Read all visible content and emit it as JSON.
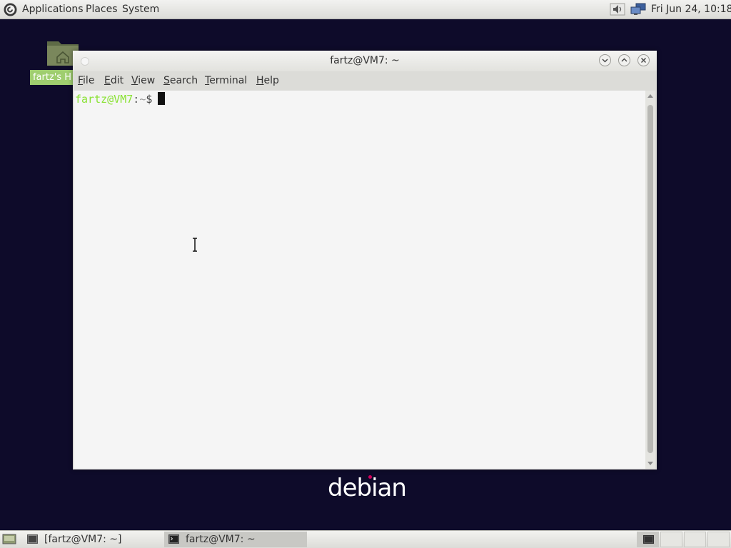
{
  "top_panel": {
    "menus": [
      "Applications",
      "Places",
      "System"
    ],
    "clock": "Fri Jun 24, 10:18",
    "icons": [
      "debian-swirl-icon",
      "volume-icon",
      "network-icon"
    ]
  },
  "desktop": {
    "home_icon_label": "fartz's H"
  },
  "terminal": {
    "title": "fartz@VM7: ~",
    "menus": [
      {
        "label": "File",
        "mnemonic": "F"
      },
      {
        "label": "Edit",
        "mnemonic": "E"
      },
      {
        "label": "View",
        "mnemonic": "V"
      },
      {
        "label": "Search",
        "mnemonic": "S"
      },
      {
        "label": "Terminal",
        "mnemonic": "T"
      },
      {
        "label": "Help",
        "mnemonic": "H"
      }
    ],
    "prompt": {
      "user_host": "fartz@VM7",
      "sep": ":",
      "path": "~",
      "dollar": "$"
    },
    "window_buttons": [
      "minimize",
      "maximize",
      "close"
    ]
  },
  "wallpaper": {
    "wordmark": "debian"
  },
  "taskbar": {
    "tasks": [
      {
        "label": "[fartz@VM7: ~]",
        "active": false
      },
      {
        "label": "fartz@VM7: ~",
        "active": true
      }
    ],
    "workspaces": 4
  },
  "colors": {
    "desktop_bg": "#0e0b2a",
    "prompt_user": "#8ae234",
    "home_label_bg": "#9fce6f",
    "terminal_bg": "#f5f5f5"
  }
}
